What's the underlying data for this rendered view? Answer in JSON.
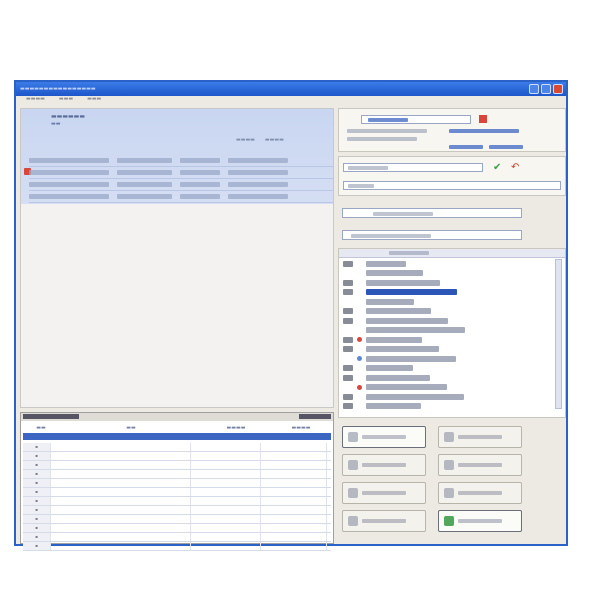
{
  "window": {
    "title_bar": {
      "has_min": true,
      "has_max": true,
      "has_close": true
    }
  },
  "left_panel": {
    "selected_rows": 4,
    "flagged_row": 2
  },
  "bottom_grid": {
    "row_count": 12
  },
  "right_panel": {
    "list_row_count": 16,
    "selected_list_index": 3,
    "action_buttons": 8
  },
  "colors": {
    "title_bar": "#1d56c9",
    "selection_band": "#c9d6f1",
    "list_highlight": "#2b56b8",
    "flag": "#d9463a",
    "ok_check": "#3e9f4a"
  },
  "icons": {
    "flag": "flag-icon",
    "check": "checkmark-icon",
    "close": "close-icon"
  }
}
